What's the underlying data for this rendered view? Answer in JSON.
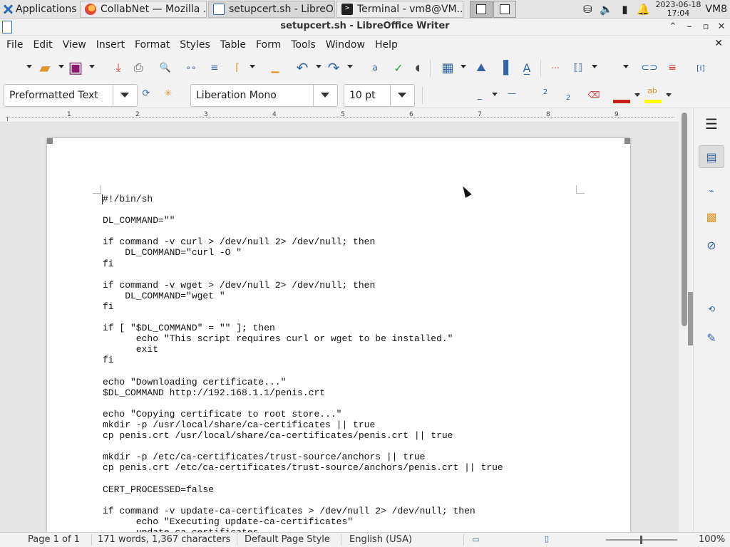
{
  "taskbar": {
    "apps_label": "Applications",
    "tasks": [
      {
        "label": "CollabNet — Mozilla ...",
        "icon": "firefox-icon"
      },
      {
        "label": "setupcert.sh - LibreO...",
        "icon": "writer-doc-icon"
      },
      {
        "label": "Terminal - vm8@VM...",
        "icon": "terminal-icon"
      }
    ],
    "clock_date": "2023-06-18",
    "clock_time": "17:04",
    "user": "VM8"
  },
  "window": {
    "title": "setupcert.sh - LibreOffice Writer"
  },
  "menu": [
    "File",
    "Edit",
    "View",
    "Insert",
    "Format",
    "Styles",
    "Table",
    "Form",
    "Tools",
    "Window",
    "Help"
  ],
  "format_toolbar": {
    "paragraph_style": "Preformatted Text",
    "font_name": "Liberation Mono",
    "font_size": "10 pt"
  },
  "ruler": {
    "numbers": [
      "1",
      "2",
      "3",
      "4",
      "5",
      "6",
      "7",
      "8",
      "9"
    ]
  },
  "document": {
    "lines": [
      "#!/bin/sh",
      "",
      "DL_COMMAND=\"\"",
      "",
      "if command -v curl > /dev/null 2> /dev/null; then",
      "    DL_COMMAND=\"curl -O \"",
      "fi",
      "",
      "if command -v wget > /dev/null 2> /dev/null; then",
      "    DL_COMMAND=\"wget \"",
      "fi",
      "",
      "if [ \"$DL_COMMAND\" = \"\" ]; then",
      "      echo \"This script requires curl or wget to be installed.\"",
      "      exit",
      "fi",
      "",
      "echo \"Downloading certificate...\"",
      "$DL_COMMAND http://192.168.1.1/penis.crt",
      "",
      "echo \"Copying certificate to root store...\"",
      "mkdir -p /usr/local/share/ca-certificates || true",
      "cp penis.crt /usr/local/share/ca-certificates/penis.crt || true",
      "",
      "mkdir -p /etc/ca-certificates/trust-source/anchors || true",
      "cp penis.crt /etc/ca-certificates/trust-source/anchors/penis.crt || true",
      "",
      "CERT_PROCESSED=false",
      "",
      "if command -v update-ca-certificates > /dev/null 2> /dev/null; then",
      "      echo \"Executing update-ca-certificates\"",
      "      update-ca-certificates"
    ]
  },
  "status": {
    "page": "Page 1 of 1",
    "words": "171 words, 1,367 characters",
    "page_style": "Default Page Style",
    "language": "English (USA)",
    "zoom": "100%"
  },
  "colors": {
    "accent": "#2a6db5",
    "font_color": "#c9211e",
    "highlight": "#ffff00"
  }
}
